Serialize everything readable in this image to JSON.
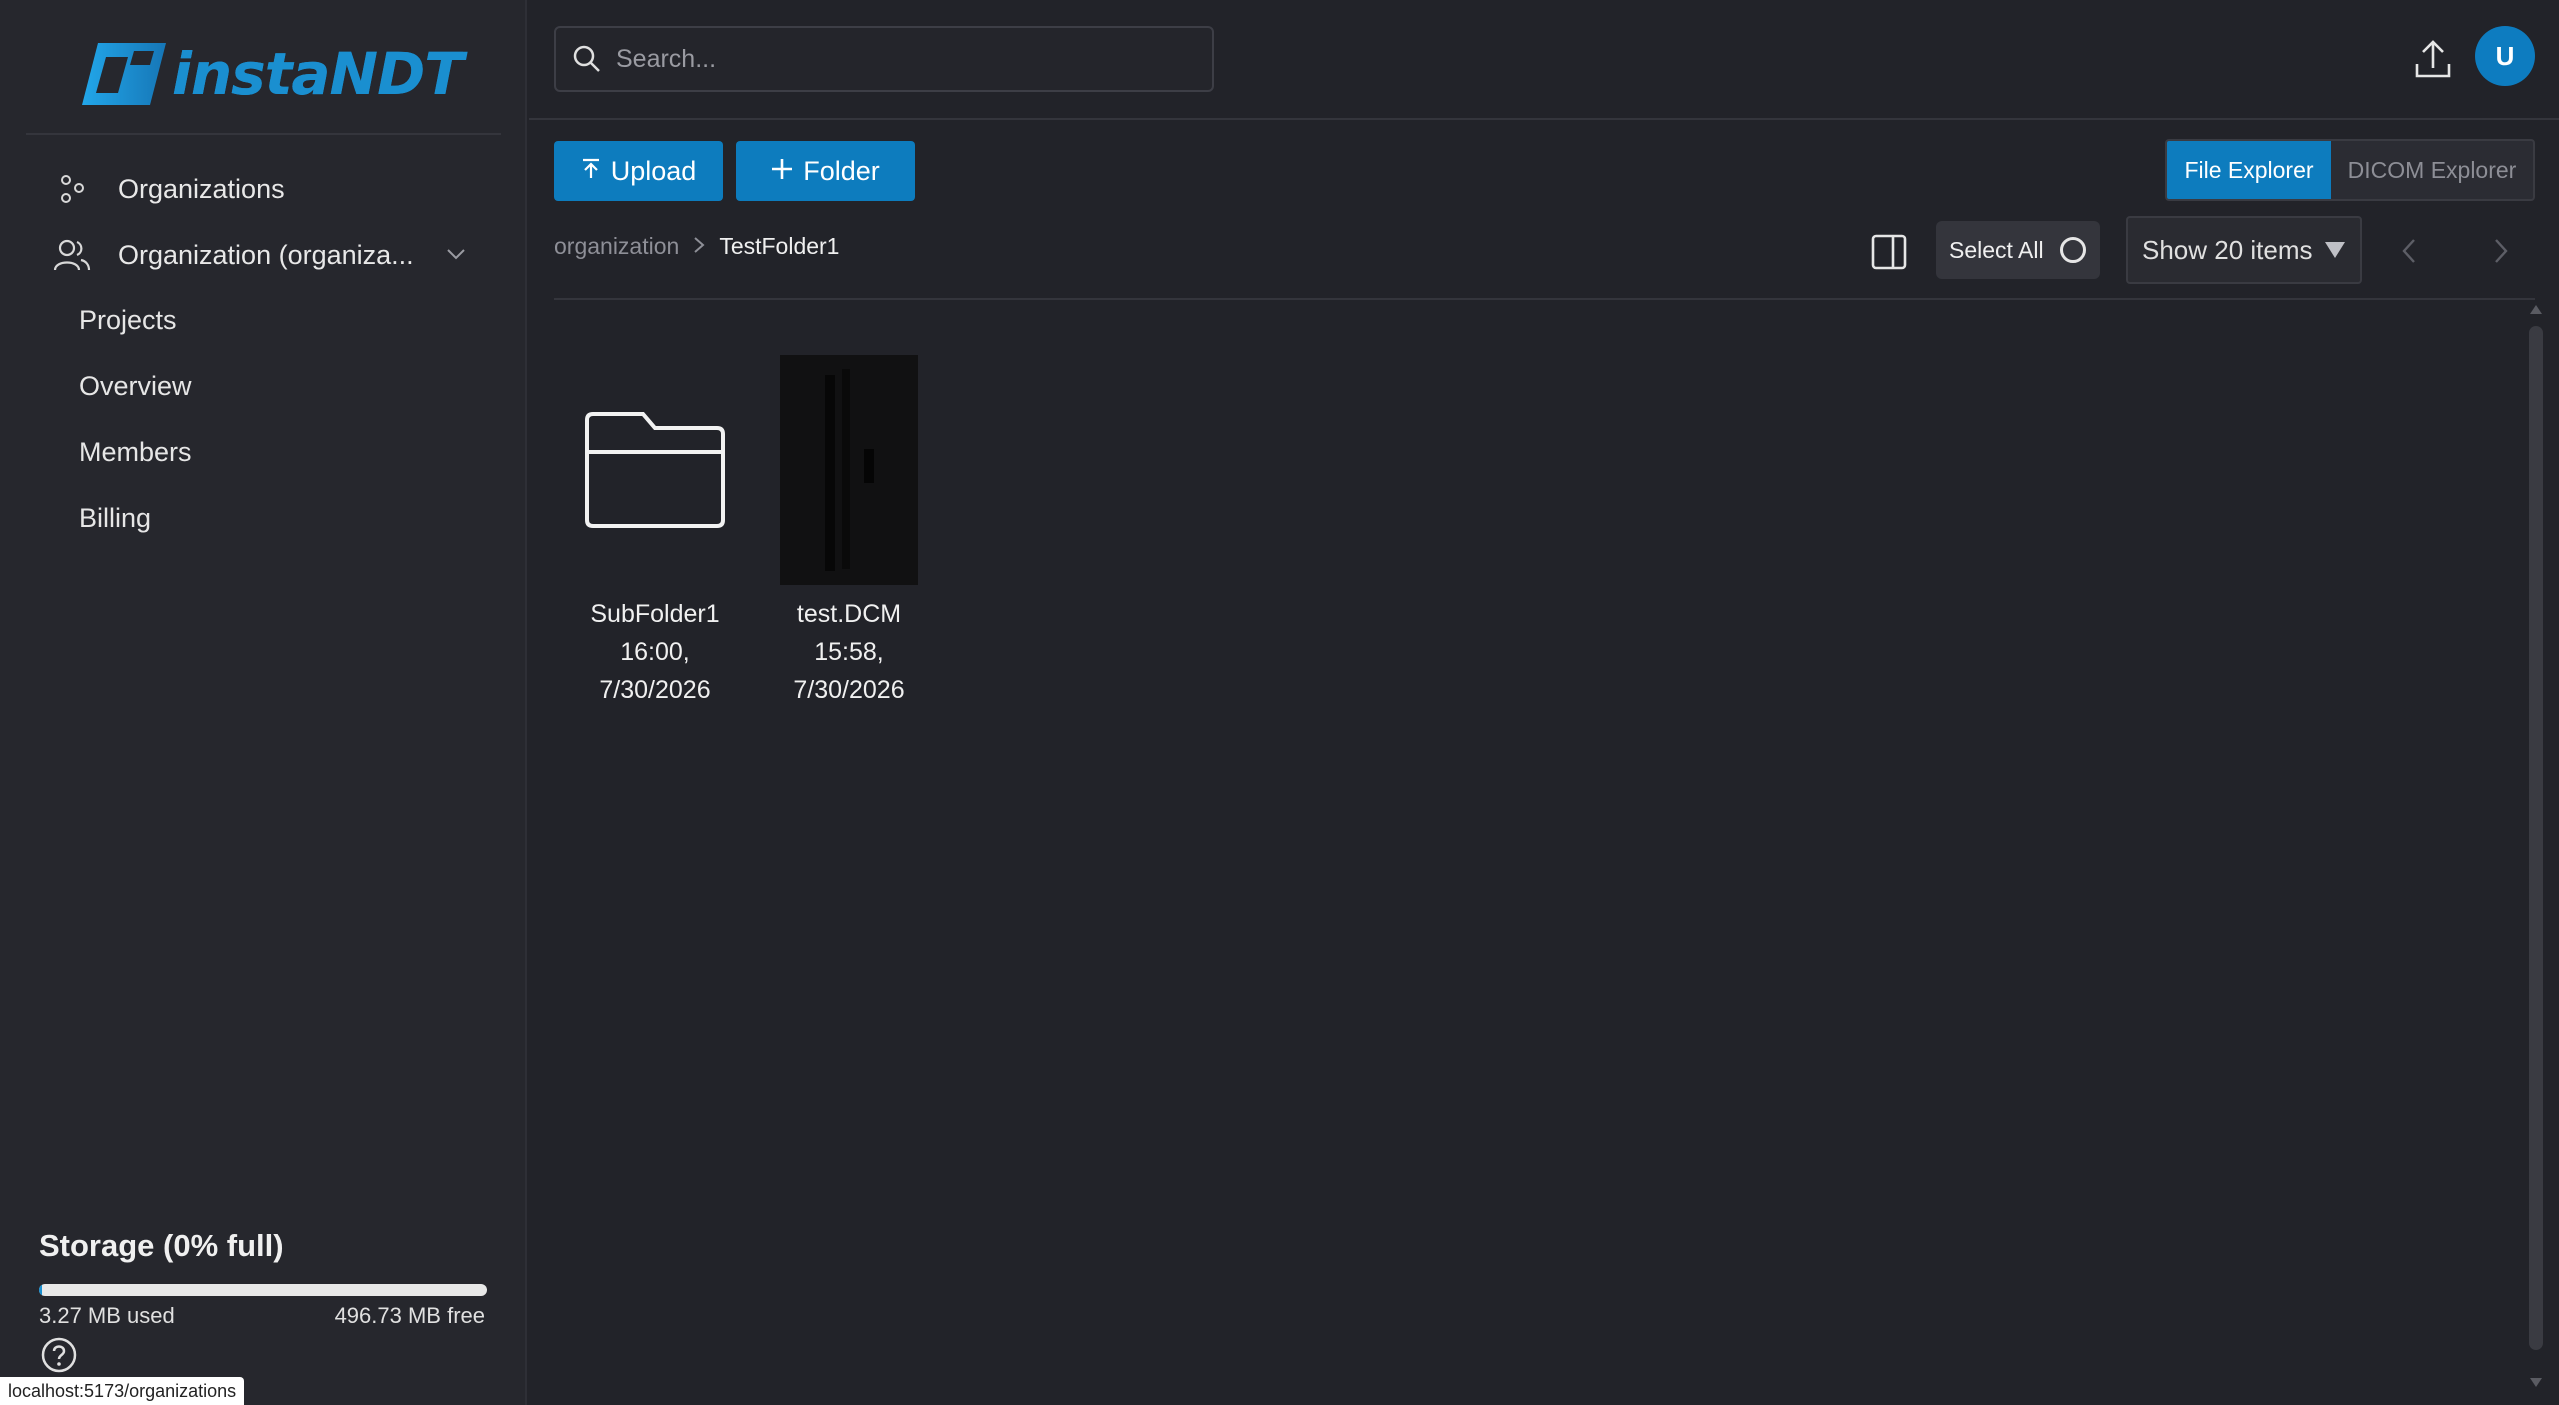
{
  "brand": {
    "name": "instaNDT",
    "accent": "#1a8fd0"
  },
  "sidebar": {
    "items": [
      {
        "label": "Organizations",
        "icon": "organizations-icon"
      },
      {
        "label": "Organization (organiza...",
        "icon": "users-icon"
      }
    ],
    "subitems": [
      {
        "label": "Projects"
      },
      {
        "label": "Overview"
      },
      {
        "label": "Members"
      },
      {
        "label": "Billing"
      }
    ],
    "storage": {
      "title": "Storage (0% full)",
      "used": "3.27 MB used",
      "free": "496.73 MB free",
      "fill_fraction": 0.0065
    },
    "status_url": "localhost:5173/organizations"
  },
  "topbar": {
    "search_placeholder": "Search...",
    "avatar_initial": "U"
  },
  "toolbar": {
    "upload_label": "Upload",
    "folder_label": "Folder",
    "views": {
      "file_explorer": "File Explorer",
      "dicom_explorer": "DICOM Explorer",
      "active": "file_explorer"
    },
    "select_all_label": "Select All",
    "show_items_label": "Show 20 items"
  },
  "breadcrumb": {
    "root": "organization",
    "current": "TestFolder1"
  },
  "files": [
    {
      "name": "SubFolder1",
      "time": "16:00,",
      "date": "7/30/2026",
      "type": "folder"
    },
    {
      "name": "test.DCM",
      "time": "15:58,",
      "date": "7/30/2026",
      "type": "dicom"
    }
  ]
}
